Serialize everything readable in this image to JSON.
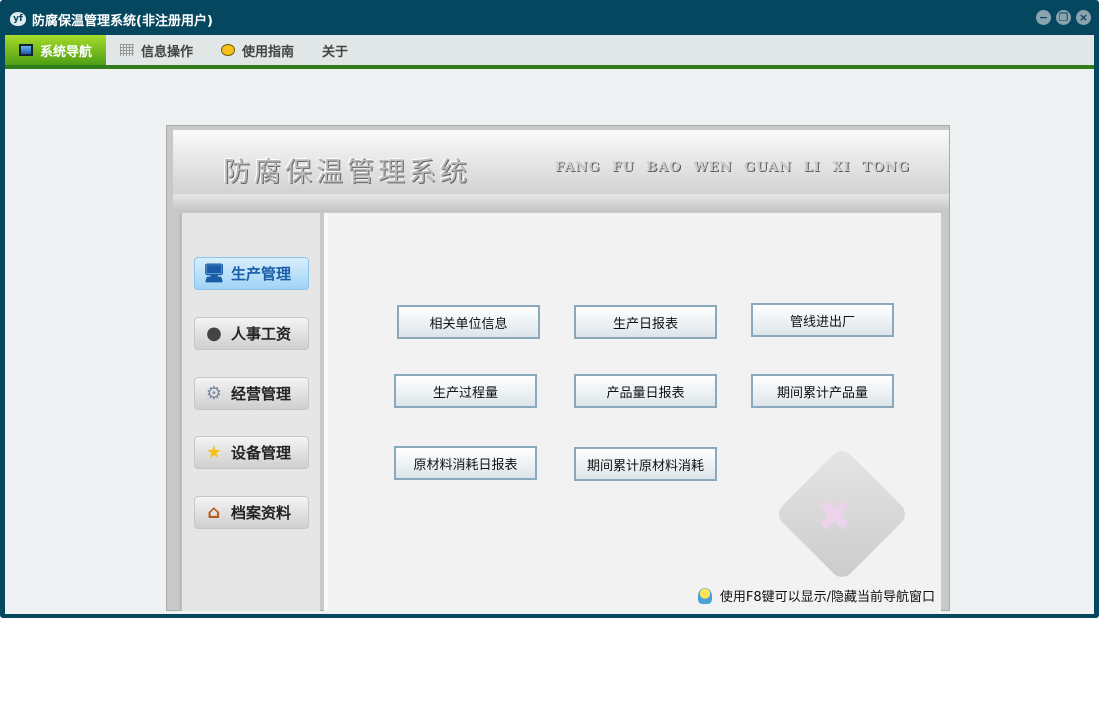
{
  "window": {
    "title": "防腐保温管理系统(非注册用户)",
    "logo": "yf",
    "controls": [
      "minimize",
      "restore",
      "close"
    ]
  },
  "menubar": [
    {
      "label": "系统导航",
      "icon": "monitor-icon",
      "active": true
    },
    {
      "label": "信息操作",
      "icon": "grid-icon",
      "active": false
    },
    {
      "label": "使用指南",
      "icon": "help-icon",
      "active": false
    },
    {
      "label": "关于",
      "active": false
    }
  ],
  "header": {
    "title": "防腐保温管理系统",
    "subtitle": "FANG FU BAO  WEN GUAN LI XI TONG"
  },
  "nav": [
    {
      "label": "生产管理",
      "icon": "monitor-icon",
      "active": true
    },
    {
      "label": "人事工资",
      "icon": "user-icon"
    },
    {
      "label": "经营管理",
      "icon": "gear-icon"
    },
    {
      "label": "设备管理",
      "icon": "star-icon"
    },
    {
      "label": "档案资料",
      "icon": "house-icon"
    }
  ],
  "functions": [
    "相关单位信息",
    "生产日报表",
    "管线进出厂",
    "生产过程量",
    "产品量日报表",
    "期间累计产品量",
    "原材料消耗日报表",
    "期间累计原材料消耗"
  ],
  "hint": "使用F8键可以显示/隐藏当前导航窗口"
}
